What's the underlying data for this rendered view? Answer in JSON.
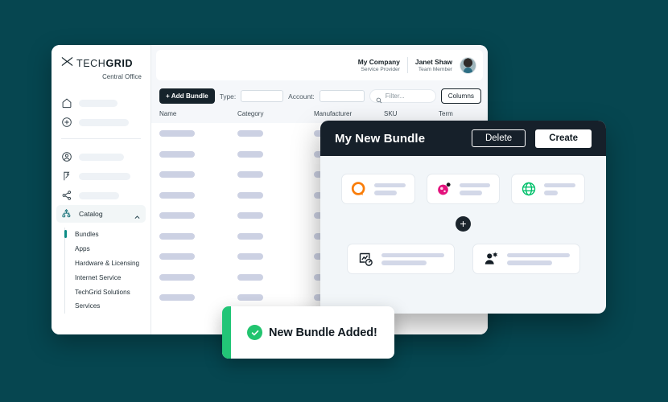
{
  "theme": {
    "page_background": "#064650",
    "accent_teal": "#0d8d86",
    "dark_surface": "#16202a",
    "success_green": "#22c46f",
    "skeleton_gray": "#ccd1e3"
  },
  "app": {
    "brand": {
      "logo_icon": "techgrid-weave-mark-icon",
      "name_light": "TECH",
      "name_bold": "GRID",
      "subtitle": "Central Office"
    },
    "sidebar": {
      "top_items": [
        {
          "icon": "home-icon",
          "label_placeholder": ""
        },
        {
          "icon": "plus-circle-icon",
          "label_placeholder": ""
        }
      ],
      "mid_items": [
        {
          "icon": "user-circle-icon",
          "label_placeholder": ""
        },
        {
          "icon": "bolt-flag-icon",
          "label_placeholder": ""
        },
        {
          "icon": "share-nodes-icon",
          "label_placeholder": ""
        }
      ],
      "group": {
        "icon": "hierarchy-icon",
        "label": "Catalog",
        "chevron": "chevron-up-icon",
        "expanded": true
      },
      "sub_items": [
        {
          "label": "Bundles",
          "active": true
        },
        {
          "label": "Apps",
          "active": false
        },
        {
          "label": "Hardware & Licensing",
          "active": false
        },
        {
          "label": "Internet Service",
          "active": false
        },
        {
          "label": "TechGrid Solutions",
          "active": false
        },
        {
          "label": "Services",
          "active": false
        }
      ]
    },
    "topbar": {
      "org_name": "My Company",
      "org_role": "Service Provider",
      "user_name": "Janet Shaw",
      "user_role": "Team Member",
      "avatar_icon": "user-avatar"
    },
    "toolbar": {
      "add_bundle_label": "+ Add Bundle",
      "type_label": "Type:",
      "type_value": "",
      "account_label": "Account:",
      "account_value": "",
      "filter_icon": "search-icon",
      "filter_placeholder": "Filter...",
      "filter_value": "",
      "columns_label": "Columns"
    },
    "table": {
      "columns": [
        "Name",
        "Category",
        "Manufacturer",
        "SKU",
        "Term"
      ],
      "row_count": 9,
      "rows_are_skeleton": true
    }
  },
  "modal": {
    "title": "My New Bundle",
    "delete_label": "Delete",
    "create_label": "Create",
    "cards_row_1": [
      {
        "icon": "orange-a-logo-icon",
        "icon_color": "#f97d09"
      },
      {
        "icon": "pink-sphere-logo-icon",
        "icon_color": "#e3127d"
      },
      {
        "icon": "green-globe-icon",
        "icon_color": "#00c06b"
      }
    ],
    "add_item_button": {
      "icon": "plus-icon",
      "label": "+"
    },
    "cards_row_2": [
      {
        "icon": "analytics-chart-icon",
        "icon_color": "#141d25"
      },
      {
        "icon": "user-settings-icon",
        "icon_color": "#141d25"
      }
    ]
  },
  "toast": {
    "icon": "check-circle-icon",
    "message": "New Bundle Added!"
  }
}
